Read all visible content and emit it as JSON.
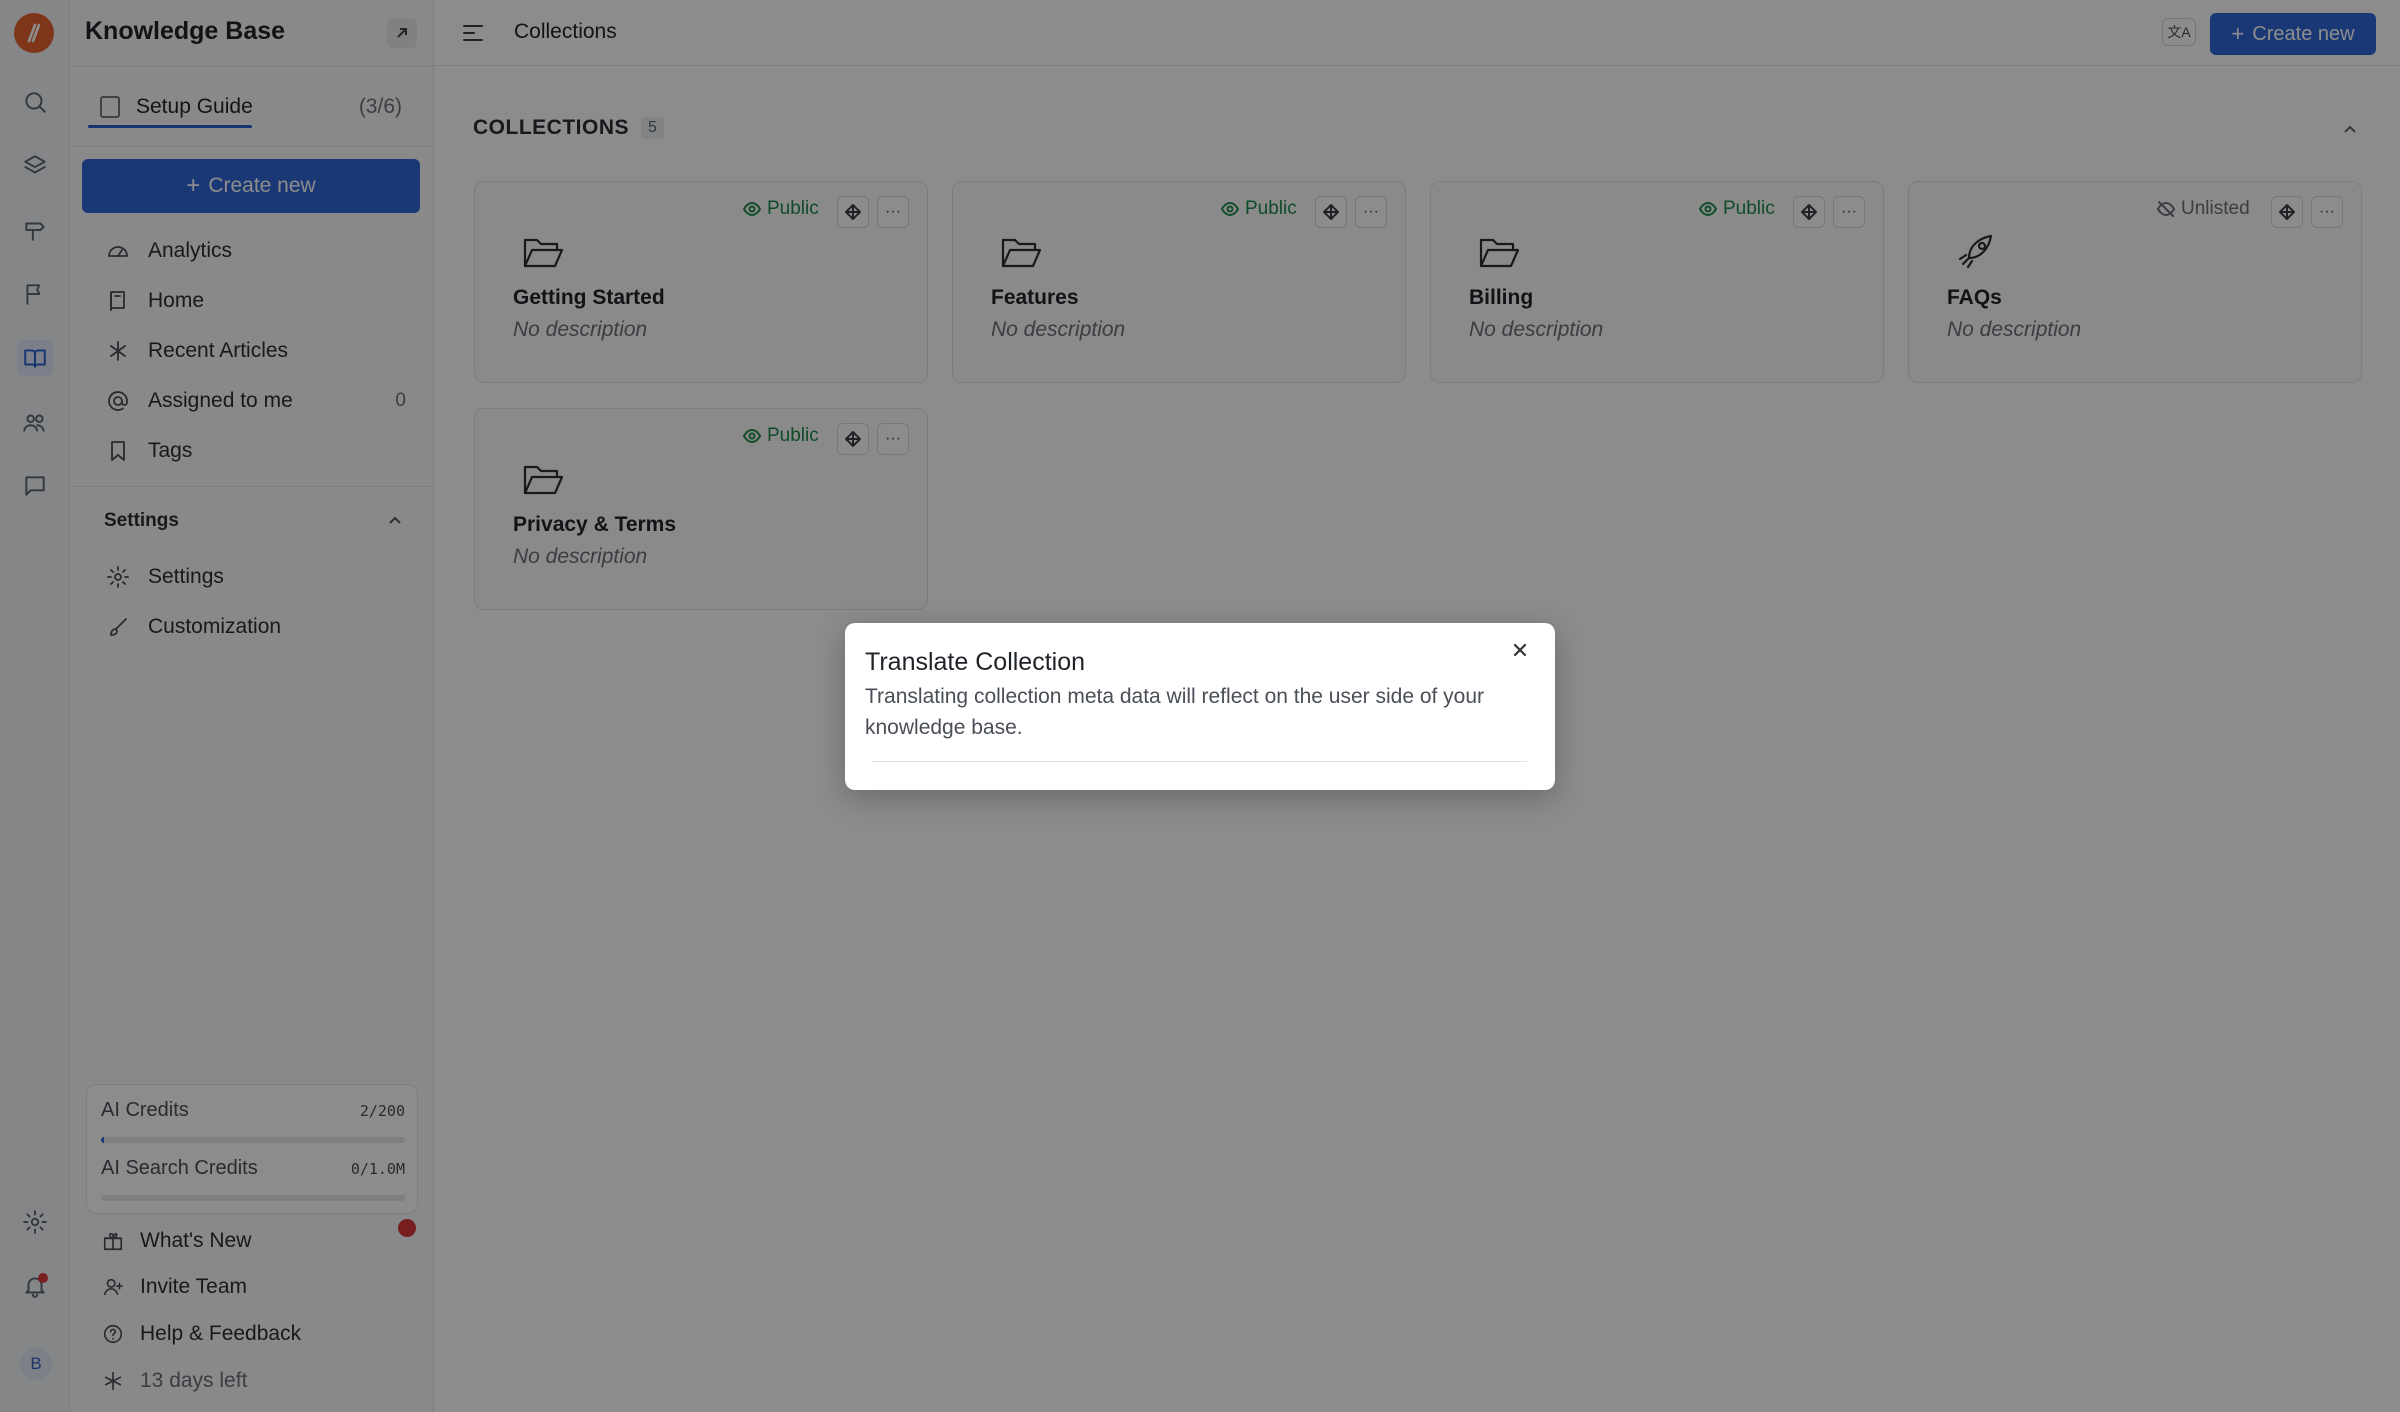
{
  "sidebar": {
    "title": "Knowledge Base",
    "setup_guide": {
      "label": "Setup Guide",
      "count": "(3/6)"
    },
    "create_new": "Create new",
    "nav": [
      {
        "label": "Analytics",
        "icon": "gauge-icon"
      },
      {
        "label": "Home",
        "icon": "book-icon"
      },
      {
        "label": "Recent Articles",
        "icon": "sparkle-icon"
      },
      {
        "label": "Assigned to me",
        "icon": "at-icon",
        "count": "0"
      },
      {
        "label": "Tags",
        "icon": "bookmark-icon"
      }
    ],
    "settings_section": {
      "title": "Settings",
      "items": [
        {
          "label": "Settings",
          "icon": "gear-icon"
        },
        {
          "label": "Customization",
          "icon": "brush-icon"
        }
      ]
    },
    "credits": [
      {
        "label": "AI Credits",
        "value": "2/200",
        "fraction": 0.01
      },
      {
        "label": "AI Search Credits",
        "value": "0/1.0M",
        "fraction": 0
      }
    ],
    "footer": [
      {
        "label": "What's New",
        "icon": "gift-icon"
      },
      {
        "label": "Invite Team",
        "icon": "user-plus-icon"
      },
      {
        "label": "Help & Feedback",
        "icon": "help-circle-icon"
      },
      {
        "label": "13 days left",
        "icon": "asterisk-icon"
      }
    ]
  },
  "rail": {
    "avatar_initial": "B"
  },
  "topbar": {
    "title": "Collections",
    "translate_glyph": "文A",
    "create_new": "Create new"
  },
  "collections": {
    "heading": "COLLECTIONS",
    "count": "5",
    "items": [
      {
        "title": "Getting Started",
        "description": "No description",
        "visibility": "Public",
        "icon": "folder-open-icon"
      },
      {
        "title": "Features",
        "description": "No description",
        "visibility": "Public",
        "icon": "folder-open-icon"
      },
      {
        "title": "Billing",
        "description": "No description",
        "visibility": "Public",
        "icon": "folder-open-icon"
      },
      {
        "title": "FAQs",
        "description": "No description",
        "visibility": "Unlisted",
        "icon": "rocket-icon"
      },
      {
        "title": "Privacy & Terms",
        "description": "No description",
        "visibility": "Public",
        "icon": "folder-open-icon"
      }
    ],
    "more_glyph": "···"
  },
  "dialog": {
    "title": "Translate Collection",
    "body": "Translating collection meta data will reflect on the user side of your knowledge base."
  },
  "colors": {
    "accent": "#2f66d5",
    "public": "#1f8a4c",
    "brand": "#e8622f"
  }
}
